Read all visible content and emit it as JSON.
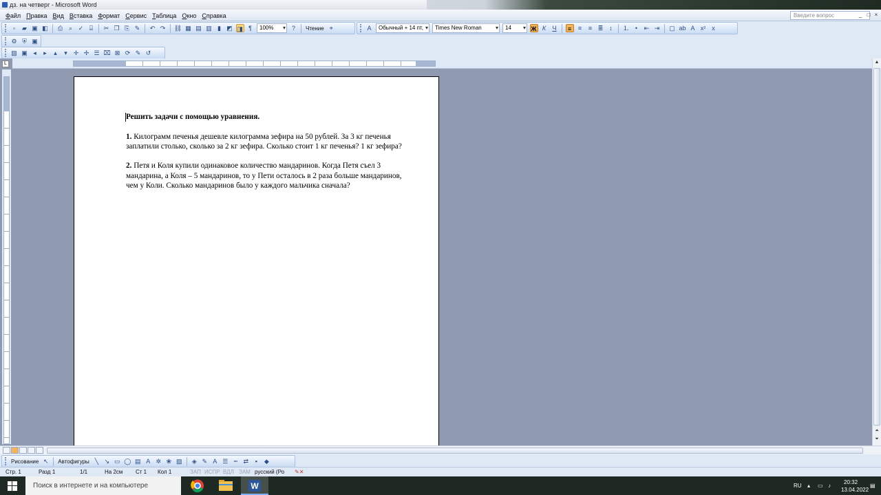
{
  "window": {
    "title": "дз. на четверг - Microsoft Word"
  },
  "menu": {
    "items": [
      "Файл",
      "Правка",
      "Вид",
      "Вставка",
      "Формат",
      "Сервис",
      "Таблица",
      "Окно",
      "Справка"
    ],
    "help_placeholder": "Введите вопрос",
    "window_controls": [
      "_",
      "□",
      "×"
    ]
  },
  "toolbar": {
    "zoom": "100%",
    "reading_label": "Чтение",
    "style": "Обычный + 14 пт,",
    "font": "Times New Roman",
    "size": "14",
    "bold": "Ж",
    "italic": "К",
    "underline": "Ч"
  },
  "document": {
    "heading": "Решить задачи с помощью уравнения.",
    "tasks": [
      {
        "number": "1.",
        "text": " Килограмм печенья дешевле килограмма зефира на 50 рублей. За 3 кг печенья заплатили столько, сколько за 2 кг зефира. Сколько стоит 1 кг печенья? 1 кг зефира?"
      },
      {
        "number": "2.",
        "text": " Петя и Коля купили одинаковое количество мандаринов. Когда Петя съел 3 мандарина, а Коля – 5 мандаринов, то у Пети осталось в 2 раза больше мандаринов, чем у Коли. Сколько мандаринов было у каждого мальчика сначала?"
      }
    ]
  },
  "drawing": {
    "draw_label": "Рисование",
    "autoshapes_label": "Автофигуры"
  },
  "status": {
    "page": "Стр. 1",
    "section": "Разд 1",
    "pages": "1/1",
    "at": "На 2см",
    "line": "Ст 1",
    "col": "Кол 1",
    "rec": "ЗАП",
    "trk": "ИСПР",
    "ext": "ВДЛ",
    "ovr": "ЗАМ",
    "language": "русский (Ро"
  },
  "taskbar": {
    "search_placeholder": "Поиск в интернете и на компьютере",
    "lang": "RU",
    "time": "20:32",
    "date": "13.04.2022"
  },
  "colors": {
    "accent": "#f6b45a",
    "toolbar": "#dfe8f5",
    "workspace": "#8f9ab0"
  }
}
